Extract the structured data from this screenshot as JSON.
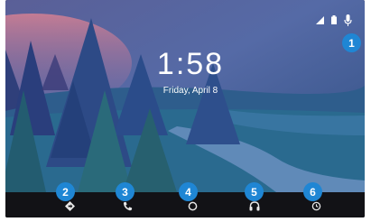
{
  "clock": {
    "time": "1:58",
    "date": "Friday, April 8"
  },
  "status_bar": {
    "icons": [
      "signal-icon",
      "battery-icon",
      "microphone-icon"
    ]
  },
  "nav_bar": {
    "buttons": [
      {
        "name": "navigation-icon"
      },
      {
        "name": "phone-icon"
      },
      {
        "name": "home-icon"
      },
      {
        "name": "headphones-icon"
      },
      {
        "name": "recents-icon"
      }
    ]
  },
  "callouts": [
    "1",
    "2",
    "3",
    "4",
    "5",
    "6"
  ],
  "colors": {
    "accent": "#1f86d4",
    "nav_bg": "#121216",
    "sky_top": "#4a5a8e",
    "sky_pink": "#c8738a"
  }
}
